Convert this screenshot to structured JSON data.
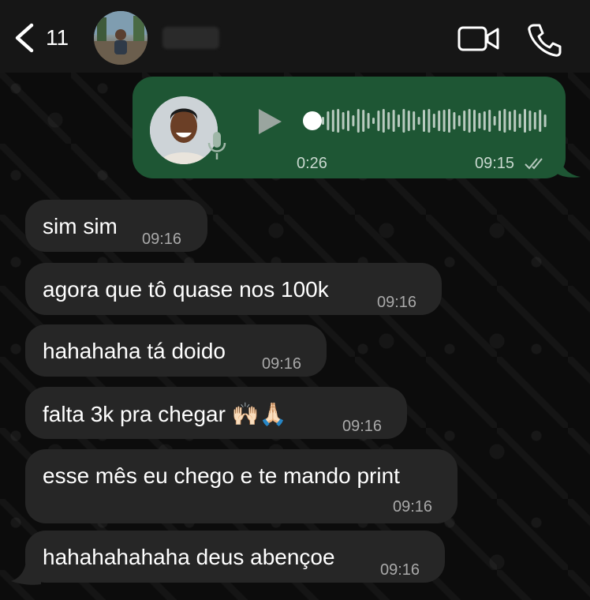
{
  "header": {
    "back_count": "11",
    "icons": [
      "chevron-left-icon",
      "video-camera-icon",
      "phone-icon"
    ]
  },
  "voice_note": {
    "duration": "0:26",
    "time": "09:15",
    "status": "read"
  },
  "messages": [
    {
      "text": "sim sim",
      "time": "09:16"
    },
    {
      "text": "agora que tô quase nos 100k",
      "time": "09:16"
    },
    {
      "text": "hahahaha tá doido",
      "time": "09:16"
    },
    {
      "text": "falta 3k pra chegar 🙌🏻🙏🏻",
      "time": "09:16"
    },
    {
      "text": "esse mês eu chego e te mando print",
      "time": "09:16"
    },
    {
      "text": "hahahahahaha deus abençoe",
      "time": "09:16"
    }
  ],
  "colors": {
    "header_bg": "#161616",
    "sent_bubble": "#1e5634",
    "received_bubble": "#262626",
    "background": "#0b0b0b"
  }
}
